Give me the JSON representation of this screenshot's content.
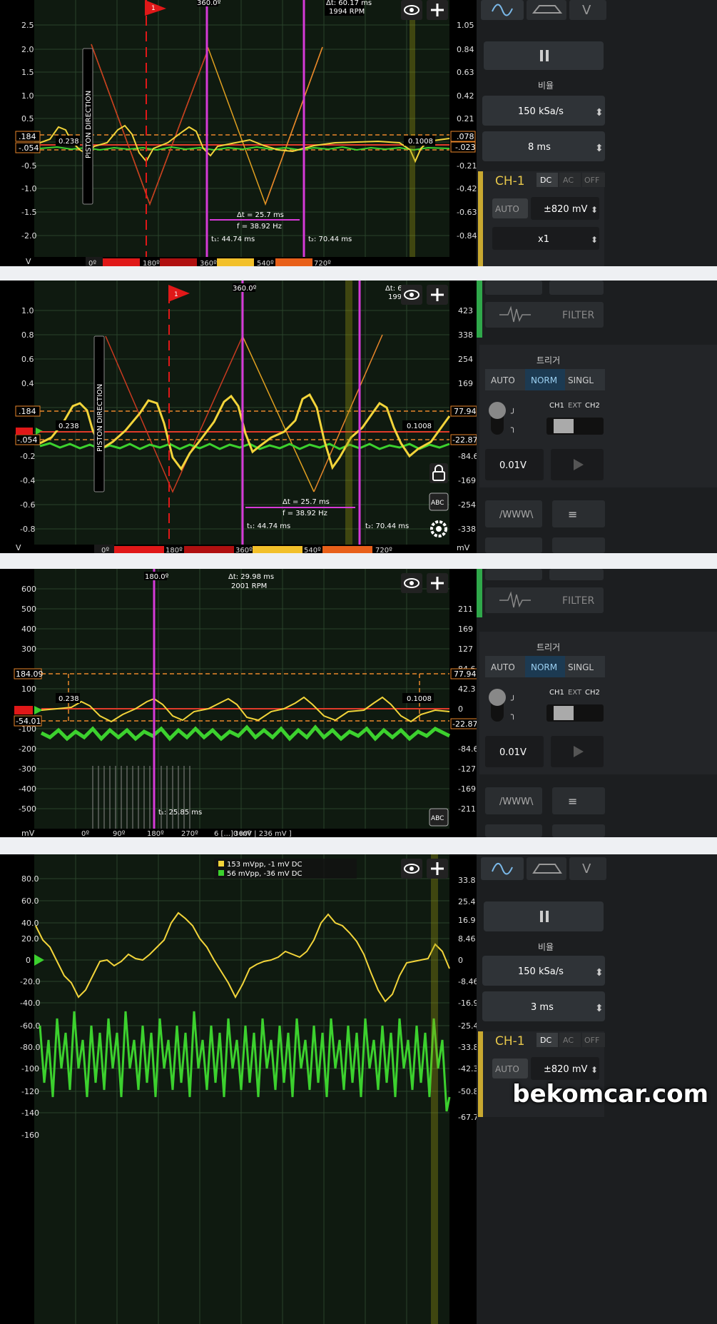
{
  "panels": [
    {
      "id": "p1",
      "top": 0,
      "left_ticks": [
        "2.5",
        "2.0",
        "1.5",
        "1.0",
        "0.5",
        "0",
        "-0.5",
        "-1.0",
        "-1.5",
        "-2.0"
      ],
      "left_unit": "V",
      "right_ticks": [
        "1.05",
        "0.84",
        "0.63",
        "0.42",
        "0.21",
        "0",
        "-0.21",
        "-0.42",
        "-0.63",
        "-0.84"
      ],
      "right_unit": "",
      "left_marker_top": ".184",
      "left_marker_bot": "-.054",
      "right_marker_top": ".078",
      "right_marker_bot": "-.023",
      "cursor_top_label": "360.0º",
      "delta_info": "Δt: 60.17 ms",
      "rpm": "1994 RPM",
      "val_left": "0.238",
      "val_right": "0.1008",
      "dt_label": "Δt = 25.7 ms",
      "f_label": "f = 38.92 Hz",
      "t1": "t₁: 44.74 ms",
      "t2": "t₂: 70.44 ms",
      "piston": "PISTON DIRECTION",
      "degrees": [
        "0º",
        "180º",
        "360º",
        "540º",
        "720º"
      ],
      "trigger_flag": "1",
      "side": {
        "rate_label": "비율",
        "sample_rate": "150 kSa/s",
        "timebase": "8 ms",
        "channel": "CH-1",
        "coupling": [
          "DC",
          "AC",
          "OFF"
        ],
        "range_mode": "AUTO",
        "range": "±820 mV",
        "probe": "x1"
      }
    },
    {
      "id": "p2",
      "left_ticks": [
        "1.0",
        "0.8",
        "0.6",
        "0.4",
        "0.2",
        "0",
        "-0.2",
        "-0.4",
        "-0.6",
        "-0.8"
      ],
      "left_unit": "V",
      "right_ticks": [
        "423",
        "338",
        "254",
        "169",
        "84.6",
        "0",
        "-84.6",
        "-169",
        "-254",
        "-338"
      ],
      "right_unit": "mV",
      "left_marker_top": ".184",
      "left_marker_bot": "-.054",
      "right_marker_top": "77.94",
      "right_marker_bot": "-22.87",
      "cursor_top_label": "360.0º",
      "delta_info": "Δt: 6",
      "rpm": "199",
      "val_left": "0.238",
      "val_right": "0.1008",
      "dt_label": "Δt = 25.7 ms",
      "f_label": "f = 38.92 Hz",
      "t1": "t₁: 44.74 ms",
      "t2": "t₂: 70.44 ms",
      "piston": "PISTON DIRECTION",
      "degrees": [
        "0º",
        "180º",
        "360º",
        "540º",
        "720º"
      ],
      "trigger_flag": "1",
      "side": {
        "filter": "FILTER",
        "trigger_label": "트리거",
        "trig_modes": [
          "AUTO",
          "NORM",
          "SINGL"
        ],
        "sources": [
          "CH1",
          "EXT",
          "CH2"
        ],
        "level": "0.01V",
        "abc": "ABC"
      }
    },
    {
      "id": "p3",
      "left_ticks": [
        "600",
        "500",
        "400",
        "300",
        "200",
        "100",
        "0",
        "-100",
        "-200",
        "-300",
        "-400",
        "-500"
      ],
      "left_unit": "mV",
      "right_ticks": [
        "211",
        "169",
        "127",
        "84.6",
        "42.3",
        "0",
        "-42.3",
        "-84.6",
        "-127",
        "-169",
        "-211"
      ],
      "left_marker_top": "184.09",
      "left_marker_bot": "-54.01",
      "right_marker_top": "77.94",
      "right_marker_bot": "-22.87",
      "cursor_top_label": "180.0º",
      "delta_info": "Δt: 29.98 ms",
      "rpm": "2001 RPM",
      "val_left": "0.238",
      "val_right": "0.1008",
      "t1": "t₁: 25.85 ms",
      "degrees": [
        "0º",
        "90º",
        "180º",
        "270º",
        "360º"
      ],
      "bottom_info": "6 [...]0 mV | 236 mV ]",
      "side": {
        "filter": "FILTER",
        "trigger_label": "트리거",
        "trig_modes": [
          "AUTO",
          "NORM",
          "SINGL"
        ],
        "sources": [
          "CH1",
          "EXT",
          "CH2"
        ],
        "level": "0.01V",
        "abc": "ABC"
      }
    },
    {
      "id": "p4",
      "left_ticks": [
        "80.0",
        "60.0",
        "40.0",
        "20.0",
        "0",
        "-20.0",
        "-40.0",
        "-60.0",
        "-80.0",
        "-100",
        "-120",
        "-140",
        "-160"
      ],
      "right_ticks": [
        "33.8",
        "25.4",
        "16.9",
        "8.46",
        "0",
        "-8.46",
        "-16.9",
        "-25.4",
        "-33.8",
        "-42.3",
        "-50.8",
        "-67.7"
      ],
      "legend_ch1": "153 mVpp, -1 mV DC",
      "legend_ch2": "56 mVpp, -36 mV DC",
      "side": {
        "rate_label": "비율",
        "sample_rate": "150 kSa/s",
        "timebase": "3 ms",
        "channel": "CH-1",
        "coupling": [
          "DC",
          "AC",
          "OFF"
        ],
        "range_mode": "AUTO",
        "range": "±820 mV"
      }
    }
  ],
  "watermark": "bekomcar.com",
  "colors": {
    "ch1": "#f2d43a",
    "ch2": "#3cd12e",
    "cursor": "#d63ad8",
    "ref": "#e03a2a",
    "grid": "#2d4a2d",
    "bg": "#0f1a10",
    "orange": "#e8862a"
  }
}
